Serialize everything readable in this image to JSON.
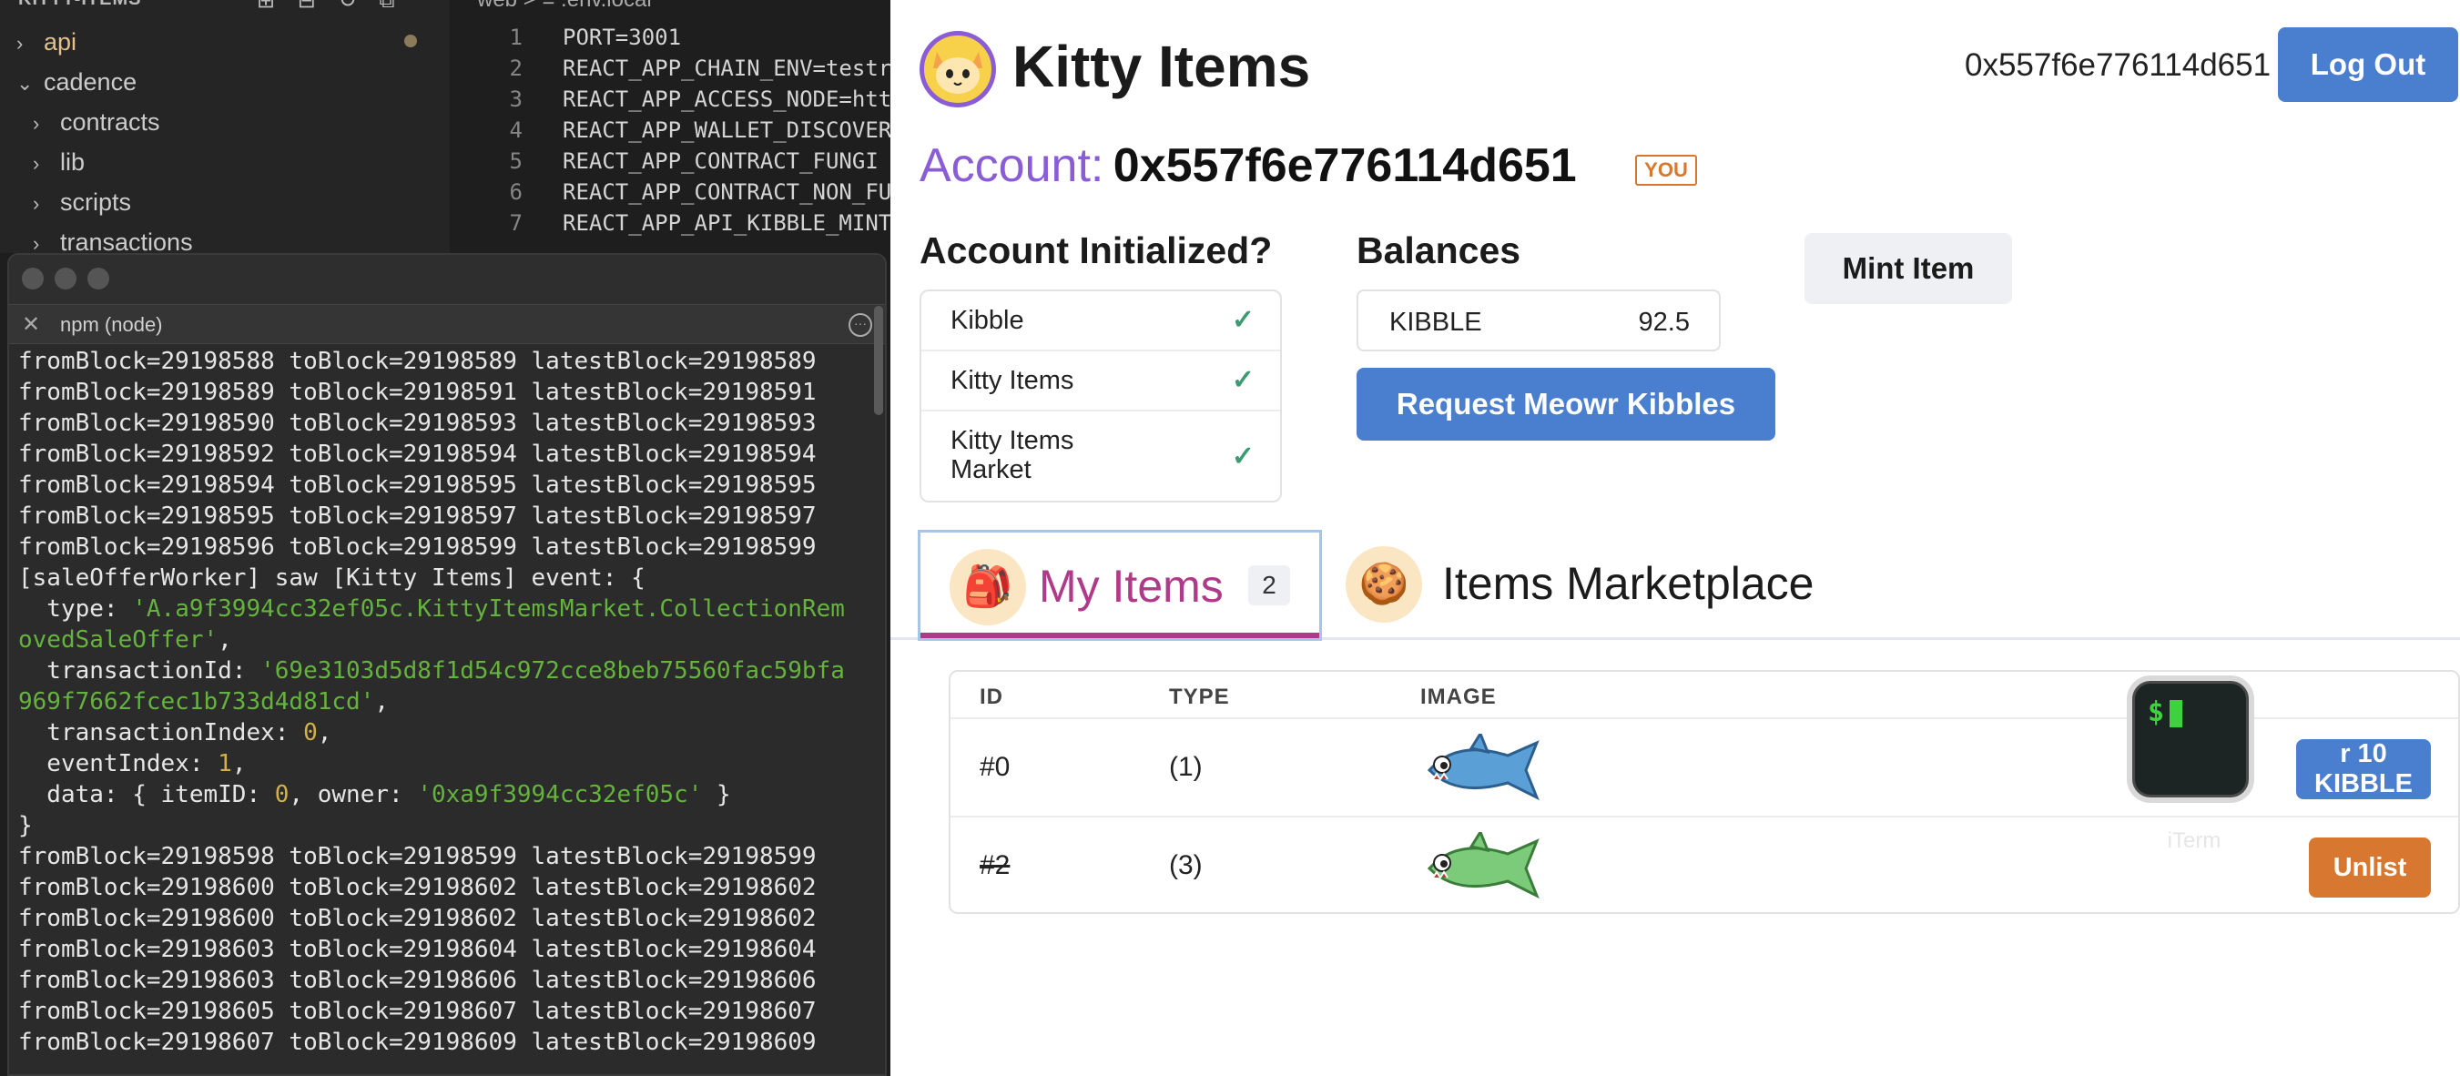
{
  "explorer": {
    "title": "KITTY-ITEMS",
    "items": [
      {
        "label": "api",
        "expanded": false
      },
      {
        "label": "cadence",
        "expanded": true
      },
      {
        "label": "contracts",
        "expanded": false
      },
      {
        "label": "lib",
        "expanded": false
      },
      {
        "label": "scripts",
        "expanded": false
      },
      {
        "label": "transactions",
        "expanded": false
      }
    ]
  },
  "editor": {
    "breadcrumb": "web > ≡ .env.local",
    "lines": [
      {
        "n": "1",
        "text": "PORT=3001"
      },
      {
        "n": "2",
        "text": "REACT_APP_CHAIN_ENV=testr"
      },
      {
        "n": "3",
        "text": "REACT_APP_ACCESS_NODE=htt"
      },
      {
        "n": "4",
        "text": "REACT_APP_WALLET_DISCOVER"
      },
      {
        "n": "5",
        "text": "REACT_APP_CONTRACT_FUNGI"
      },
      {
        "n": "6",
        "text": "REACT_APP_CONTRACT_NON_FU"
      },
      {
        "n": "7",
        "text": "REACT_APP_API_KIBBLE_MINT"
      }
    ]
  },
  "terminal": {
    "tab_title": "npm (node)",
    "lines": [
      "fromBlock=29198588 toBlock=29198589 latestBlock=29198589",
      "fromBlock=29198589 toBlock=29198591 latestBlock=29198591",
      "fromBlock=29198590 toBlock=29198593 latestBlock=29198593",
      "fromBlock=29198592 toBlock=29198594 latestBlock=29198594",
      "fromBlock=29198594 toBlock=29198595 latestBlock=29198595",
      "fromBlock=29198595 toBlock=29198597 latestBlock=29198597",
      "fromBlock=29198596 toBlock=29198599 latestBlock=29198599",
      "[saleOfferWorker] saw [Kitty Items] event: {",
      "  type: 'A.a9f3994cc32ef05c.KittyItemsMarket.CollectionRem",
      "ovedSaleOffer',",
      "  transactionId: '69e3103d5d8f1d54c972cce8beb75560fac59bfa",
      "969f7662fcec1b733d4d81cd',",
      "  transactionIndex: 0,",
      "  eventIndex: 1,",
      "  data: { itemID: 0, owner: '0xa9f3994cc32ef05c' }",
      "}",
      "fromBlock=29198598 toBlock=29198599 latestBlock=29198599",
      "fromBlock=29198600 toBlock=29198602 latestBlock=29198602",
      "fromBlock=29198600 toBlock=29198602 latestBlock=29198602",
      "fromBlock=29198603 toBlock=29198604 latestBlock=29198604",
      "fromBlock=29198603 toBlock=29198606 latestBlock=29198606",
      "fromBlock=29198605 toBlock=29198607 latestBlock=29198607",
      "fromBlock=29198607 toBlock=29198609 latestBlock=29198609"
    ]
  },
  "app": {
    "brand": "Kitty Items",
    "header_address": "0x557f6e776114d651",
    "logout_label": "Log Out",
    "account_label": "Account:",
    "account_address": "0x557f6e776114d651",
    "you_badge": "YOU",
    "init_title": "Account Initialized?",
    "init_rows": [
      {
        "label": "Kibble",
        "checked": "✓"
      },
      {
        "label": "Kitty Items",
        "checked": "✓"
      },
      {
        "label": "Kitty Items Market",
        "checked": "✓"
      }
    ],
    "balances_title": "Balances",
    "balance": {
      "token": "KIBBLE",
      "amount": "92.5"
    },
    "request_label": "Request Meowr Kibbles",
    "mint_label": "Mint Item",
    "tabs": {
      "my_items": "My Items",
      "my_items_count": "2",
      "marketplace": "Items Marketplace"
    },
    "table": {
      "headers": [
        "ID",
        "TYPE",
        "IMAGE"
      ],
      "rows": [
        {
          "id": "#0",
          "type": "(1)",
          "action": "r 10 KIBBLE",
          "action_color": "#4a7fcf"
        },
        {
          "id": "#2",
          "type": "(3)",
          "action": "Unlist",
          "action_color": "#d8772f"
        }
      ]
    },
    "dock_label": "iTerm",
    "colors": {
      "accent_blue": "#4a7fcf",
      "accent_purple": "#8a5cd6",
      "accent_pink": "#b03a8a",
      "accent_orange": "#d8772f",
      "check_green": "#3d9b72"
    }
  }
}
